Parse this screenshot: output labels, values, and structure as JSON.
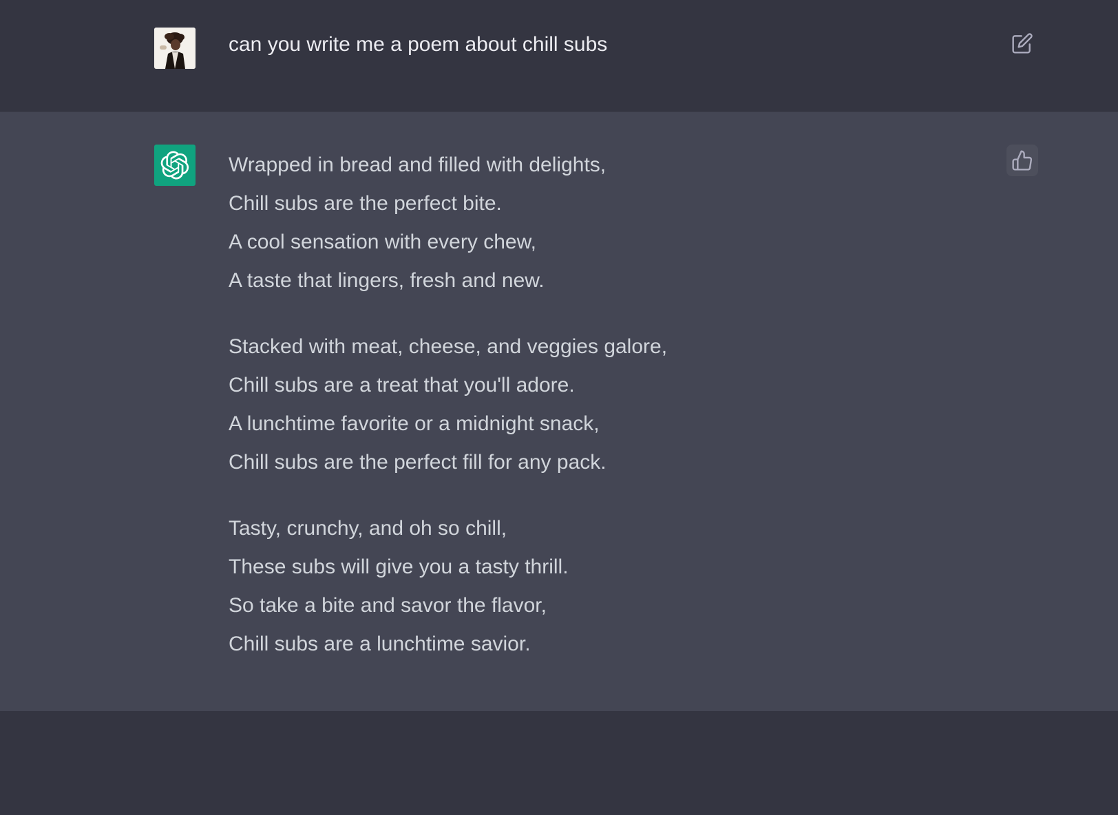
{
  "user_message": {
    "text": "can you write me a poem about chill subs",
    "avatar": "user-photo",
    "action_icon": "edit-icon"
  },
  "assistant_message": {
    "avatar": "openai-logo",
    "action_icon": "thumbs-up-icon",
    "stanzas": [
      [
        "Wrapped in bread and filled with delights,",
        "Chill subs are the perfect bite.",
        "A cool sensation with every chew,",
        "A taste that lingers, fresh and new."
      ],
      [
        "Stacked with meat, cheese, and veggies galore,",
        "Chill subs are a treat that you'll adore.",
        "A lunchtime favorite or a midnight snack,",
        "Chill subs are the perfect fill for any pack."
      ],
      [
        "Tasty, crunchy, and oh so chill,",
        "These subs will give you a tasty thrill.",
        "So take a bite and savor the flavor,",
        "Chill subs are a lunchtime savior."
      ]
    ]
  },
  "colors": {
    "background": "#343541",
    "assistant_background": "#444654",
    "bot_avatar": "#10a37f",
    "user_text": "#ececf1",
    "assistant_text": "#d1d5db"
  }
}
